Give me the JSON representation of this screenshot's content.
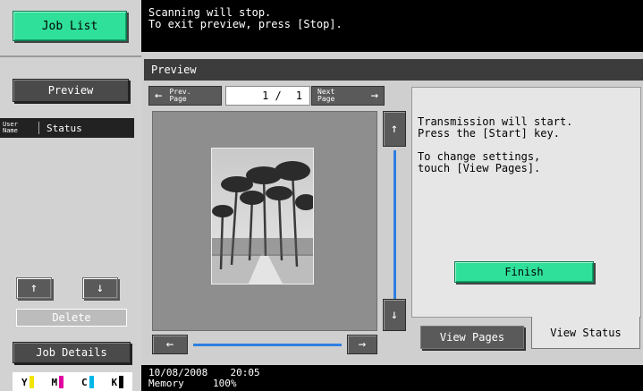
{
  "sidebar": {
    "job_list_label": "Job List",
    "preview_label": "Preview",
    "table_headers": {
      "user_name": "User\nName",
      "status": "Status"
    },
    "up_arrow": "↑",
    "down_arrow": "↓",
    "delete_label": "Delete",
    "job_details_label": "Job Details",
    "toner": [
      {
        "label": "Y",
        "color": "#f2e400"
      },
      {
        "label": "M",
        "color": "#e000a0"
      },
      {
        "label": "C",
        "color": "#00b8e8"
      },
      {
        "label": "K",
        "color": "#000000"
      }
    ]
  },
  "message": {
    "line1": "Scanning will stop.",
    "line2": "To exit preview, press [Stop]."
  },
  "preview": {
    "title": "Preview",
    "prev_page_line1": "Prev.",
    "prev_page_line2": "Page",
    "next_page_line1": "Next",
    "next_page_line2": "Page",
    "page_current": "1 /",
    "page_total": "1"
  },
  "info": {
    "line1": "Transmission will start.",
    "line2": "Press the [Start] key.",
    "line3": "To change settings,",
    "line4": "touch [View Pages].",
    "finish_label": "Finish"
  },
  "tabs": {
    "view_pages": "View Pages",
    "view_status": "View Status"
  },
  "status_bar": {
    "date": "10/08/2008",
    "time": "20:05",
    "memory_label": "Memory",
    "memory_value": "100%"
  },
  "colors": {
    "accent_green": "#2fe09a",
    "scroll_blue": "#2f7fe0"
  }
}
